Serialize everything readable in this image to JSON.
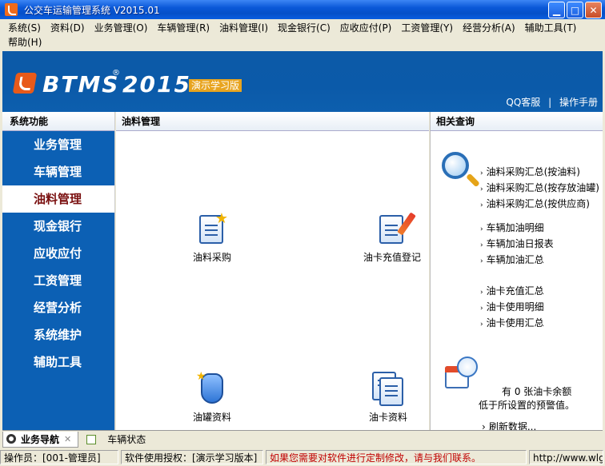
{
  "window": {
    "title": "公交车运输管理系统 V2015.01",
    "buttons": {
      "minimize": "▁",
      "maximize": "□",
      "close": "✕"
    }
  },
  "menu": [
    "系统(S)",
    "资料(D)",
    "业务管理(O)",
    "车辆管理(R)",
    "油料管理(I)",
    "现金银行(C)",
    "应收应付(P)",
    "工资管理(Y)",
    "经营分析(A)",
    "辅助工具(T)",
    "帮助(H)"
  ],
  "banner": {
    "logo_text": "BTMS",
    "registered": "®",
    "year": "2015",
    "edition": "演示学习版",
    "links": [
      "QQ客服",
      "操作手册"
    ],
    "separator": "|"
  },
  "sidebar": {
    "header": "系统功能",
    "items": [
      {
        "label": "业务管理",
        "active": false
      },
      {
        "label": "车辆管理",
        "active": false
      },
      {
        "label": "油料管理",
        "active": true
      },
      {
        "label": "现金银行",
        "active": false
      },
      {
        "label": "应收应付",
        "active": false
      },
      {
        "label": "工资管理",
        "active": false
      },
      {
        "label": "经营分析",
        "active": false
      },
      {
        "label": "系统维护",
        "active": false
      },
      {
        "label": "辅助工具",
        "active": false
      }
    ]
  },
  "main": {
    "header": "油料管理",
    "tiles": [
      {
        "label": "油料采购",
        "icon": "document-star-icon"
      },
      {
        "label": "油卡充值登记",
        "icon": "document-pencil-icon"
      },
      {
        "label": "油罐资料",
        "icon": "hand-pointer-icon"
      },
      {
        "label": "油卡资料",
        "icon": "documents-icon"
      }
    ]
  },
  "related": {
    "header": "相关查询",
    "groups": [
      [
        "油料采购汇总(按油料)",
        "油料采购汇总(按存放油罐)",
        "油料采购汇总(按供应商)"
      ],
      [
        "车辆加油明细",
        "车辆加油日报表",
        "车辆加油汇总"
      ],
      [
        "油卡充值汇总",
        "油卡使用明细",
        "油卡使用汇总"
      ]
    ],
    "arrow": "›",
    "warning_line1": "有 0 张油卡余额",
    "warning_line2": "低于所设置的预警值。",
    "refresh": "刷新数据..."
  },
  "tabs": [
    {
      "label": "业务导航",
      "active": true,
      "close": "✕"
    },
    {
      "label": "车辆状态",
      "active": false
    }
  ],
  "status": {
    "operator": "操作员：[001-管理员]",
    "license": "软件使用授权：[演示学习版本]",
    "notice": "如果您需要对软件进行定制修改，请与我们联系。",
    "website": "http://www.wlgl..."
  }
}
